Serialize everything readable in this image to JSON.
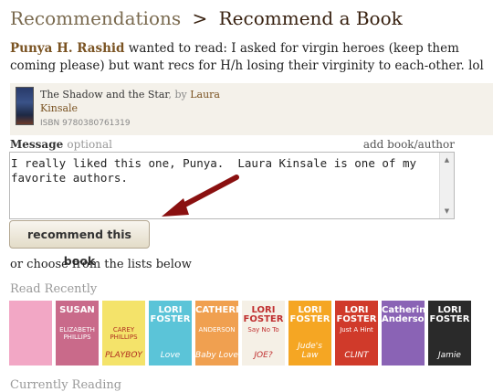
{
  "breadcrumb": {
    "section": "Recommendations",
    "separator": ">",
    "page": "Recommend a Book"
  },
  "request": {
    "user": "Punya H. Rashid",
    "text": " wanted to read: I asked for virgin heroes (keep them coming please) but want recs for H/h losing their virginity to each-other. lol"
  },
  "book": {
    "title": "The Shadow and the Star",
    "by": ", by ",
    "author": "Laura Kinsale",
    "isbn": "ISBN 9780380761319"
  },
  "message": {
    "label": "Message",
    "optional": "optional",
    "add_link": "add book/author",
    "text": "I really liked this one, Punya.  Laura Kinsale is one of my favorite authors."
  },
  "recommend_button": "recommend this book",
  "choose_text": "or choose from the lists below",
  "read_recently": {
    "label": "Read Recently",
    "covers": [
      {
        "top": "",
        "sub": "",
        "bottom": "",
        "bg": "#f2a7c5",
        "fg": "#c0306a"
      },
      {
        "top": "SUSAN",
        "sub": "ELIZABETH PHILLIPS",
        "bottom": "",
        "bg": "#c96a8a",
        "fg": "#ffffff"
      },
      {
        "top": "",
        "sub": "CAREY PHILLIPS",
        "bottom": "PLAYBOY",
        "bg": "#f4e36a",
        "fg": "#b03020"
      },
      {
        "top": "LORI FOSTER",
        "sub": "",
        "bottom": "Love",
        "bg": "#5bc4d8",
        "fg": "#ffffff"
      },
      {
        "top": "CATHERINE",
        "sub": "ANDERSON",
        "bottom": "Baby Love",
        "bg": "#f0a050",
        "fg": "#ffffff"
      },
      {
        "top": "LORI FOSTER",
        "sub": "Say No To",
        "bottom": "JOE?",
        "bg": "#f5f0e6",
        "fg": "#c03030"
      },
      {
        "top": "LORI FOSTER",
        "sub": "",
        "bottom": "Jude's Law",
        "bg": "#f5a623",
        "fg": "#ffffff"
      },
      {
        "top": "LORI FOSTER",
        "sub": "Just A Hint",
        "bottom": "CLINT",
        "bg": "#d03a2a",
        "fg": "#ffffff"
      },
      {
        "top": "Catherine Anderson",
        "sub": "",
        "bottom": "",
        "bg": "#8a63b5",
        "fg": "#ffffff"
      },
      {
        "top": "LORI FOSTER",
        "sub": "",
        "bottom": "Jamie",
        "bg": "#2a2a2a",
        "fg": "#ffffff"
      }
    ]
  },
  "next_section": "Currently Reading"
}
